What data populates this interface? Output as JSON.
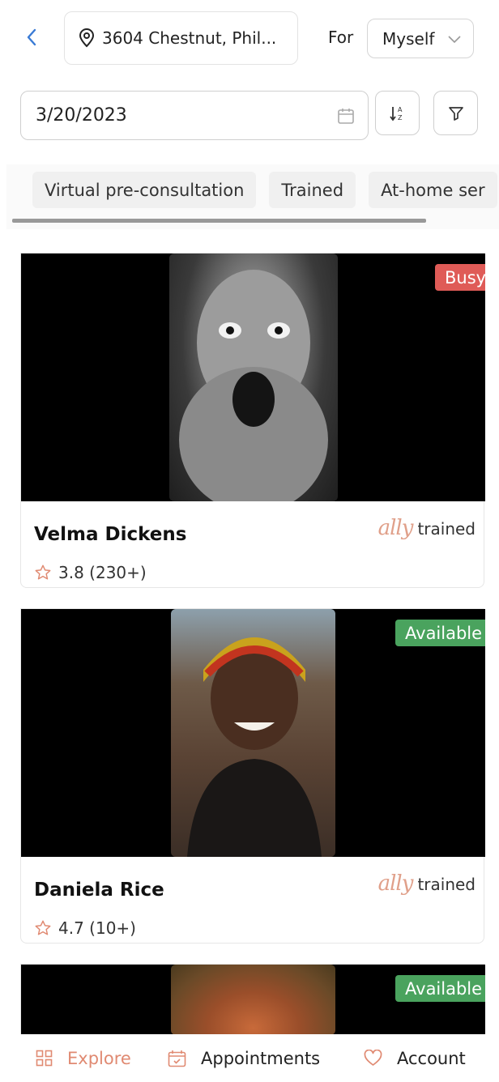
{
  "header": {
    "location": "3604 Chestnut, Phil...",
    "for_label": "For",
    "for_value": "Myself"
  },
  "filters": {
    "date": "3/20/2023"
  },
  "chips": [
    "Virtual pre-consultation",
    "Trained",
    "At-home ser"
  ],
  "cards": [
    {
      "status": "Busy",
      "name": "Velma Dickens",
      "trained_logo": "ally",
      "trained_text": "trained",
      "rating": "3.8 (230+)"
    },
    {
      "status": "Available",
      "name": "Daniela Rice",
      "trained_logo": "ally",
      "trained_text": "trained",
      "rating": "4.7 (10+)"
    },
    {
      "status": "Available"
    }
  ],
  "nav": {
    "explore": "Explore",
    "appointments": "Appointments",
    "account": "Account"
  },
  "colors": {
    "accent": "#e08a72",
    "busy": "#df5b57",
    "available": "#4aa35e",
    "back": "#3a7bd5"
  },
  "icons": [
    "chevron-left-icon",
    "location-pin-icon",
    "chevron-down-icon",
    "calendar-icon",
    "sort-az-icon",
    "filter-icon",
    "star-icon",
    "grid-icon",
    "calendar-check-icon",
    "heart-icon"
  ]
}
